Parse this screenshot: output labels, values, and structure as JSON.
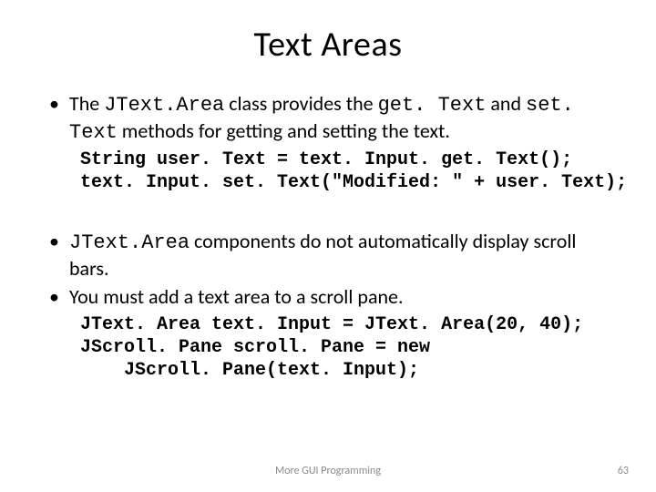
{
  "title": "Text Areas",
  "bullets": {
    "b1_pre": "The ",
    "b1_c1": "JText.Area",
    "b1_mid1": " class provides the ",
    "b1_c2": "get. Text",
    "b1_mid2": " and ",
    "b1_c3": "set. Text",
    "b1_post": " methods for getting and setting the text.",
    "code1_l1": "String user. Text = text. Input. get. Text();",
    "code1_l2": "text. Input. set. Text(\"Modified: \" + user. Text);",
    "b2_c1": "JText.Area",
    "b2_post": " components do not automatically display scroll bars.",
    "b3": "You must add a text area to a scroll pane.",
    "code2_l1": "JText. Area text. Input = JText. Area(20, 40);",
    "code2_l2": "JScroll. Pane scroll. Pane = new",
    "code2_l3": "JScroll. Pane(text. Input);"
  },
  "footer": {
    "center": "More GUI Programming",
    "page": "63"
  }
}
